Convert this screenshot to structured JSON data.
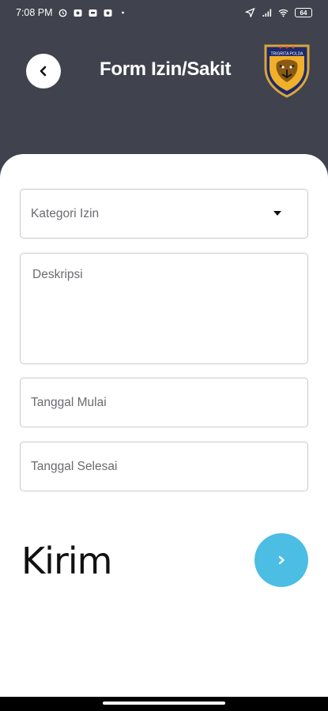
{
  "status_bar": {
    "time": "7:08 PM",
    "battery": "64",
    "icons": [
      "alarm-icon",
      "notification-icon",
      "chat-icon",
      "notification-icon",
      "dot-icon",
      "location-icon",
      "signal-icon",
      "wifi-icon",
      "battery-icon"
    ]
  },
  "header": {
    "title": "Form Izin/Sakit",
    "back_icon": "chevron-left-icon",
    "logo_text": "TRIGRITA POLDA"
  },
  "form": {
    "category_placeholder": "Kategori Izin",
    "description_placeholder": "Deskripsi",
    "start_date_placeholder": "Tanggal Mulai",
    "end_date_placeholder": "Tanggal Selesai"
  },
  "submit": {
    "label": "Kirim",
    "icon": "chevron-right-icon"
  },
  "colors": {
    "header_bg": "#40424d",
    "accent": "#4cbde3",
    "field_border": "#c9c9cc"
  }
}
